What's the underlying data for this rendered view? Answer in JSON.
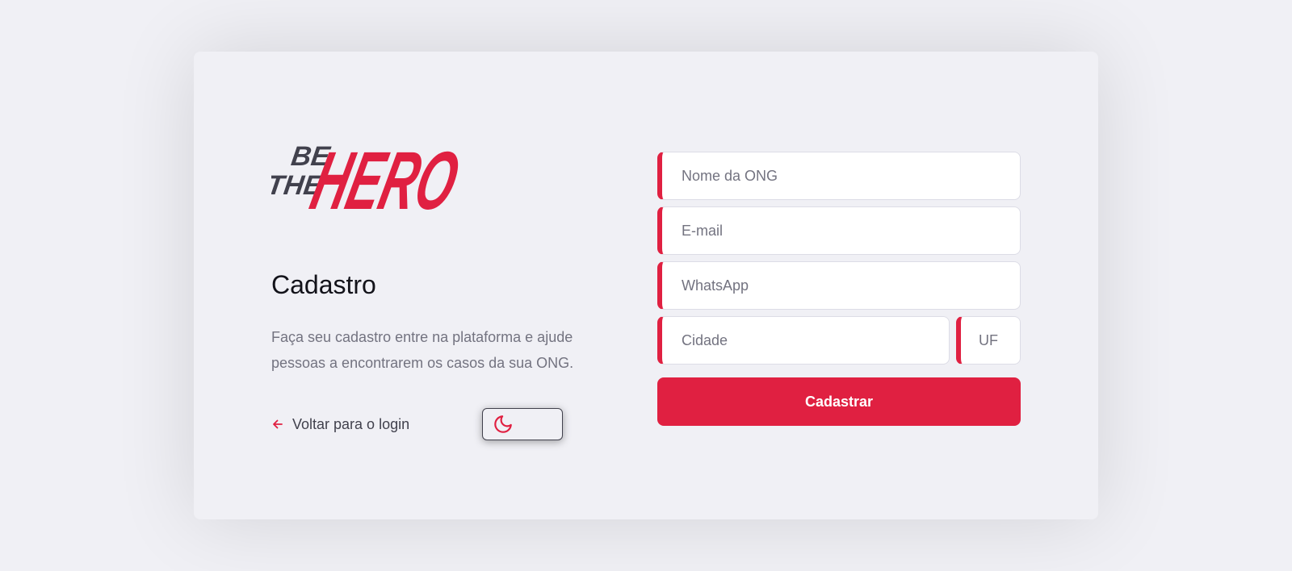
{
  "brand": {
    "line1": "BE",
    "line2": "THE",
    "name": "HERO"
  },
  "register": {
    "title": "Cadastro",
    "description": "Faça seu cadastro entre na plataforma e ajude pessoas a encontrarem os casos da sua ONG.",
    "back_link": "Voltar para o login"
  },
  "form": {
    "name_placeholder": "Nome da ONG",
    "email_placeholder": "E-mail",
    "whatsapp_placeholder": "WhatsApp",
    "city_placeholder": "Cidade",
    "uf_placeholder": "UF",
    "submit_label": "Cadastrar"
  },
  "icons": {
    "back": "arrow-left-icon",
    "theme": "moon-icon"
  },
  "colors": {
    "accent": "#e02041",
    "background": "#f0f0f5",
    "text_dark": "#13131a",
    "text_muted": "#737380",
    "logo_dark": "#41414d"
  }
}
